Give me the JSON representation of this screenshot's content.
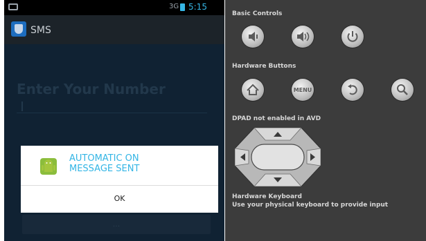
{
  "phone": {
    "status_bar": {
      "time": "5:15",
      "signal": "3G"
    },
    "action_bar": {
      "title": "SMS"
    },
    "form": {
      "enter_label": "Enter Your Number",
      "bottom_button_label": "... "
    },
    "dialog": {
      "title": "AUTOMATIC ON\nMESSAGE SENT",
      "ok_label": "OK"
    }
  },
  "emulator": {
    "basic_controls_label": "Basic Controls",
    "hardware_buttons_label": "Hardware Buttons",
    "dpad_label": "DPAD not enabled in AVD",
    "hardware_keyboard_label": "Hardware Keyboard",
    "keyboard_hint": "Use your physical keyboard to provide input",
    "menu_label": "MENU"
  },
  "colors": {
    "accent": "#33b5e5",
    "emulator_bg": "#3c3c3c",
    "phone_bg": "#102233"
  }
}
